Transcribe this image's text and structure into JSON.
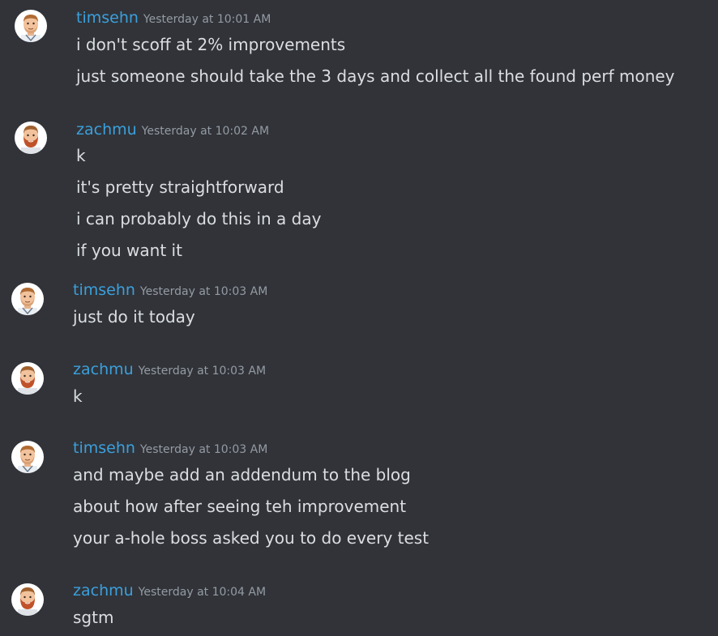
{
  "colors": {
    "background": "#313338",
    "username": "#3ba0dd",
    "timestamp": "#949ba4",
    "text": "#dbdee1"
  },
  "messages": [
    {
      "author": "timsehn",
      "avatar": "timsehn-avatar",
      "timestamp": "Yesterday at 10:01 AM",
      "lines": [
        "i don't scoff at 2% improvements",
        "just someone should take the 3 days and collect all the found perf money"
      ]
    },
    {
      "author": "zachmu",
      "avatar": "zachmu-avatar",
      "timestamp": "Yesterday at 10:02 AM",
      "lines": [
        "k",
        "it's pretty straightforward",
        "i can probably do this in a day",
        "if you want it"
      ]
    },
    {
      "author": "timsehn",
      "avatar": "timsehn-avatar",
      "timestamp": "Yesterday at 10:03 AM",
      "lines": [
        "just do it today"
      ]
    },
    {
      "author": "zachmu",
      "avatar": "zachmu-avatar",
      "timestamp": "Yesterday at 10:03 AM",
      "lines": [
        "k"
      ]
    },
    {
      "author": "timsehn",
      "avatar": "timsehn-avatar",
      "timestamp": "Yesterday at 10:03 AM",
      "lines": [
        "and maybe add an addendum to the blog",
        "about how after seeing teh improvement",
        "your a-hole boss asked you to do every test"
      ]
    },
    {
      "author": "zachmu",
      "avatar": "zachmu-avatar",
      "timestamp": "Yesterday at 10:04 AM",
      "lines": [
        "sgtm"
      ]
    }
  ]
}
